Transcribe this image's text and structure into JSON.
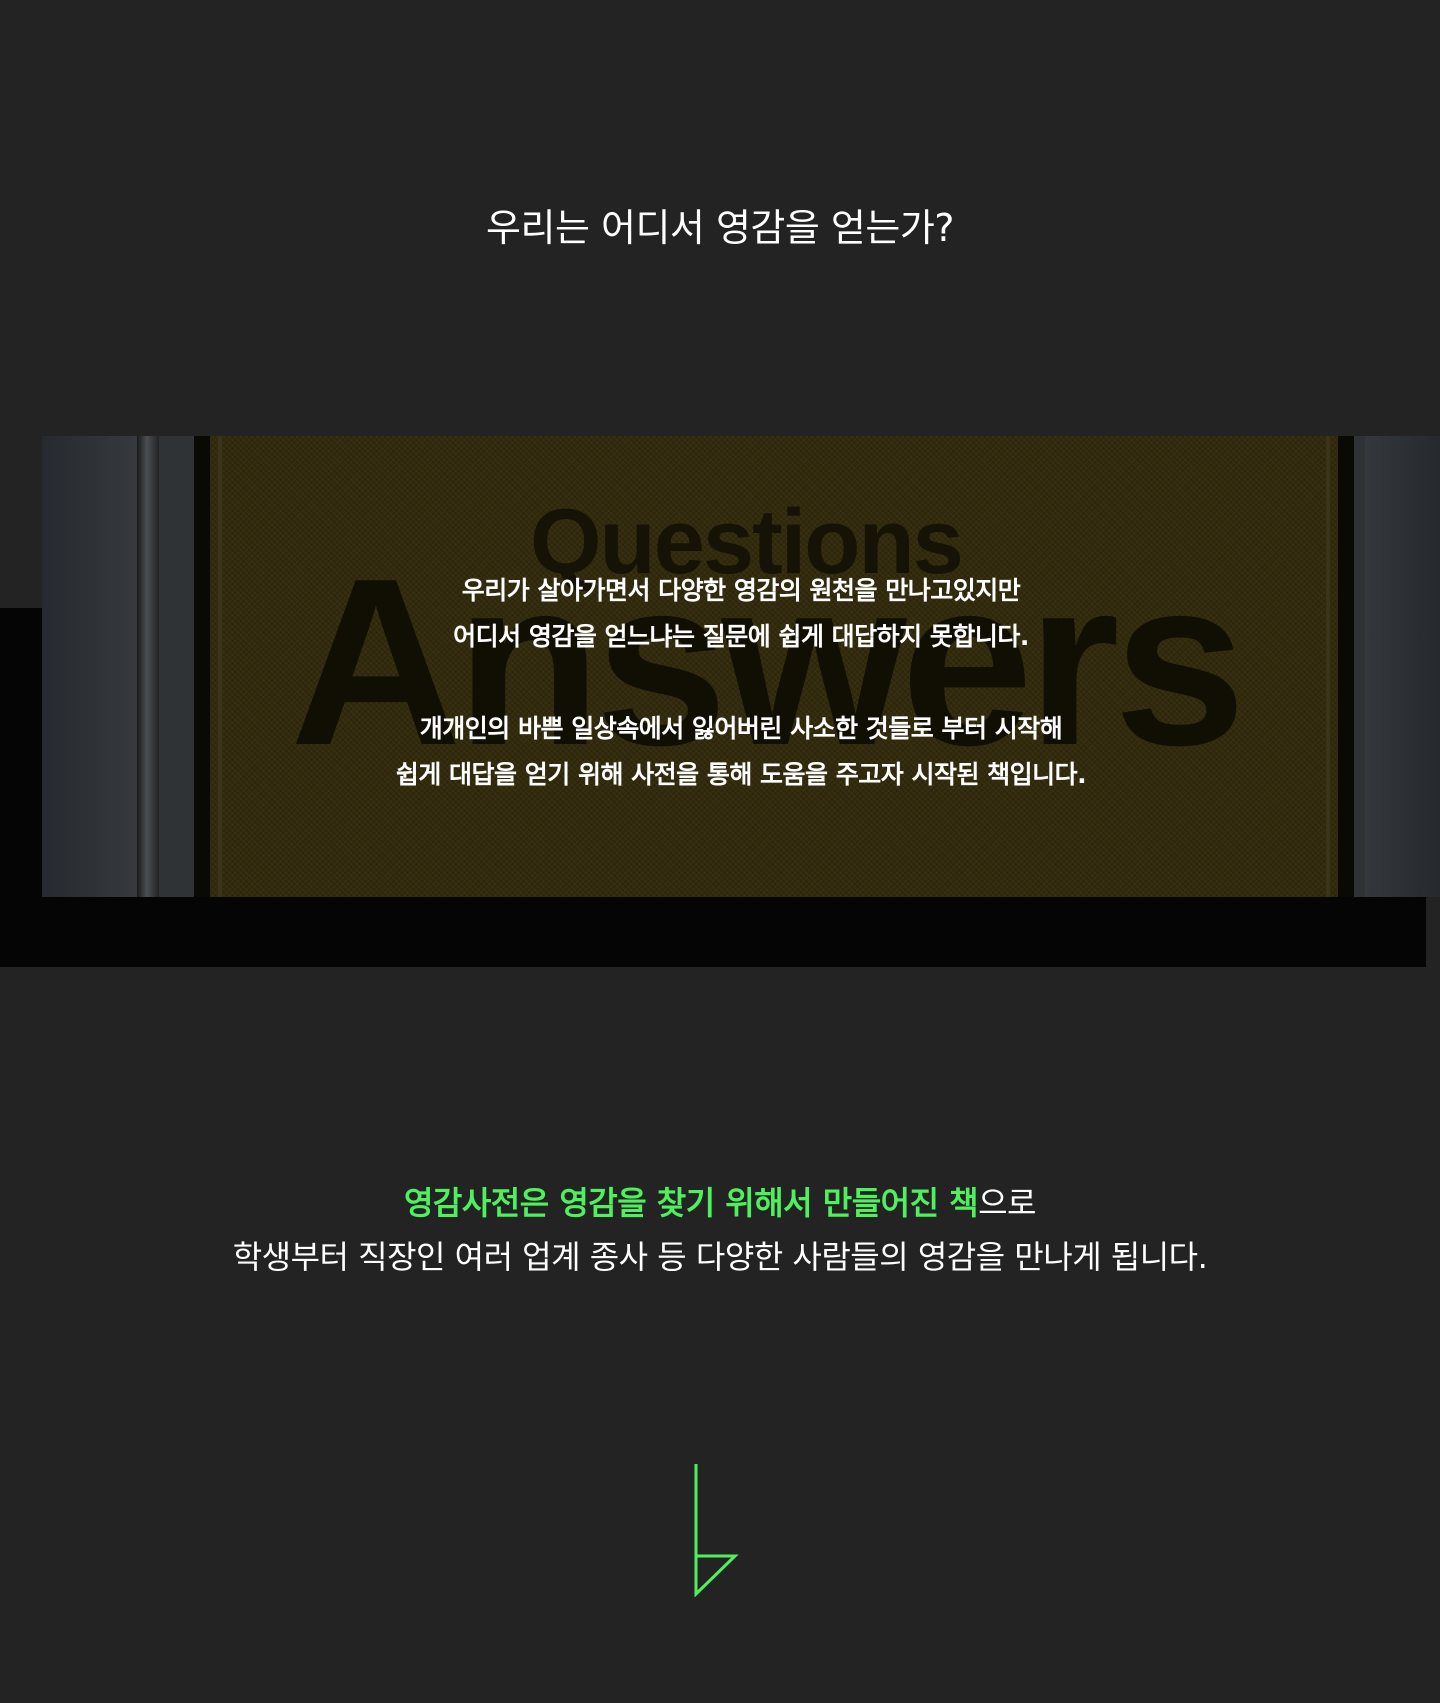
{
  "heading": "우리는 어디서 영감을 얻는가?",
  "hero": {
    "sign_word_small": "Questions",
    "sign_word_big": "Answers",
    "paragraph1_line1": "우리가 살아가면서 다양한 영감의 원천을 만나고있지만",
    "paragraph1_line2": "어디서 영감을 얻느냐는 질문에 쉽게 대답하지 못합니다.",
    "paragraph2_line1": "개개인의 바쁜 일상속에서 잃어버린 사소한 것들로 부터 시작해",
    "paragraph2_line2": "쉽게 대답을 얻기 위해 사전을 통해 도움을 주고자 시작된 책입니다."
  },
  "summary": {
    "line1_highlight": "영감사전은 영감을  찾기 위해서  만들어진 책",
    "line1_suffix": "으로",
    "line2": "학생부터 직장인 여러 업계 종사 등 다양한 사람들의  영감을  만나게 됩니다."
  },
  "logo": {
    "icon": "brand-mark-icon",
    "color": "#4ff05e"
  },
  "colors": {
    "background": "#232323",
    "accent": "#4ff05e",
    "text": "#ffffff"
  }
}
